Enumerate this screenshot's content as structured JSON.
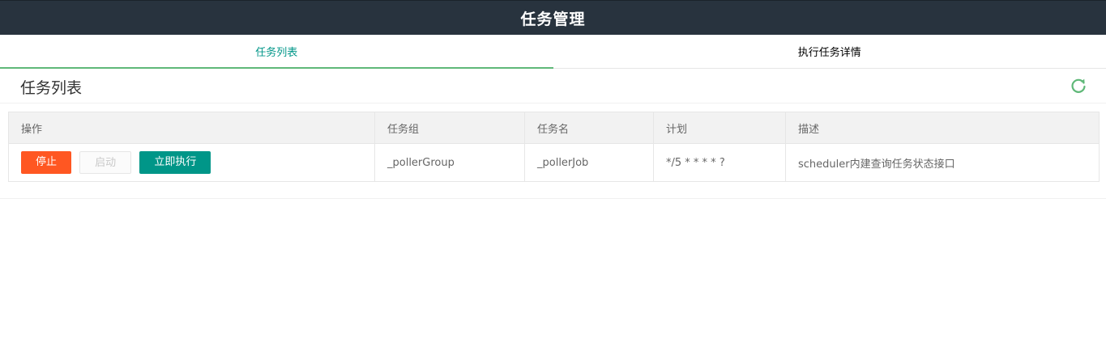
{
  "header": {
    "title": "任务管理"
  },
  "tabs": [
    {
      "label": "任务列表",
      "active": true
    },
    {
      "label": "执行任务详情",
      "active": false
    }
  ],
  "card": {
    "title": "任务列表",
    "refresh_icon": "refresh-icon"
  },
  "table": {
    "columns": [
      "操作",
      "任务组",
      "任务名",
      "计划",
      "描述"
    ],
    "rows": [
      {
        "actions": {
          "stop": "停止",
          "start": "启动",
          "run_now": "立即执行"
        },
        "group": "_pollerGroup",
        "name": "_pollerJob",
        "cron": "*/5 * * * * ?",
        "description": "scheduler内建查询任务状态接口"
      }
    ]
  },
  "colors": {
    "accent": "#009688",
    "danger": "#ff5722",
    "header_bg": "#28333e",
    "tab_underline": "#5fb878"
  }
}
